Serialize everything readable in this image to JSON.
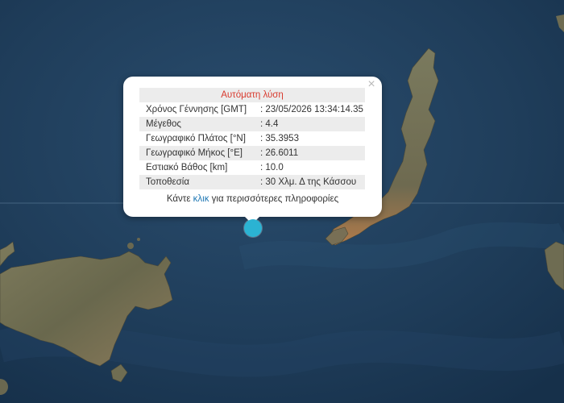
{
  "map": {
    "colors": {
      "sea": "#1f3d5a",
      "land": "#6b6b52",
      "graticule": "#5e7e9a",
      "marker": "#2bb3d3"
    }
  },
  "popup": {
    "close_glyph": "×",
    "title": "Αυτόματη λύση",
    "rows": [
      {
        "label": "Χρόνος Γέννησης [GMT]",
        "value": ": 23/05/2026 13:34:14.35"
      },
      {
        "label": "Μέγεθος",
        "value": ": 4.4"
      },
      {
        "label": "Γεωγραφικό Πλάτος [°N]",
        "value": ": 35.3953"
      },
      {
        "label": "Γεωγραφικό Μήκος [°E]",
        "value": ": 26.6011"
      },
      {
        "label": "Εστιακό Βάθος [km]",
        "value": ": 10.0"
      },
      {
        "label": "Τοποθεσία",
        "value": ": 30 Χλμ. Δ της Κάσσου"
      }
    ],
    "more_prefix": "Κάντε ",
    "more_link": "κλικ",
    "more_suffix": " για περισσότερες πληροφορίες"
  }
}
